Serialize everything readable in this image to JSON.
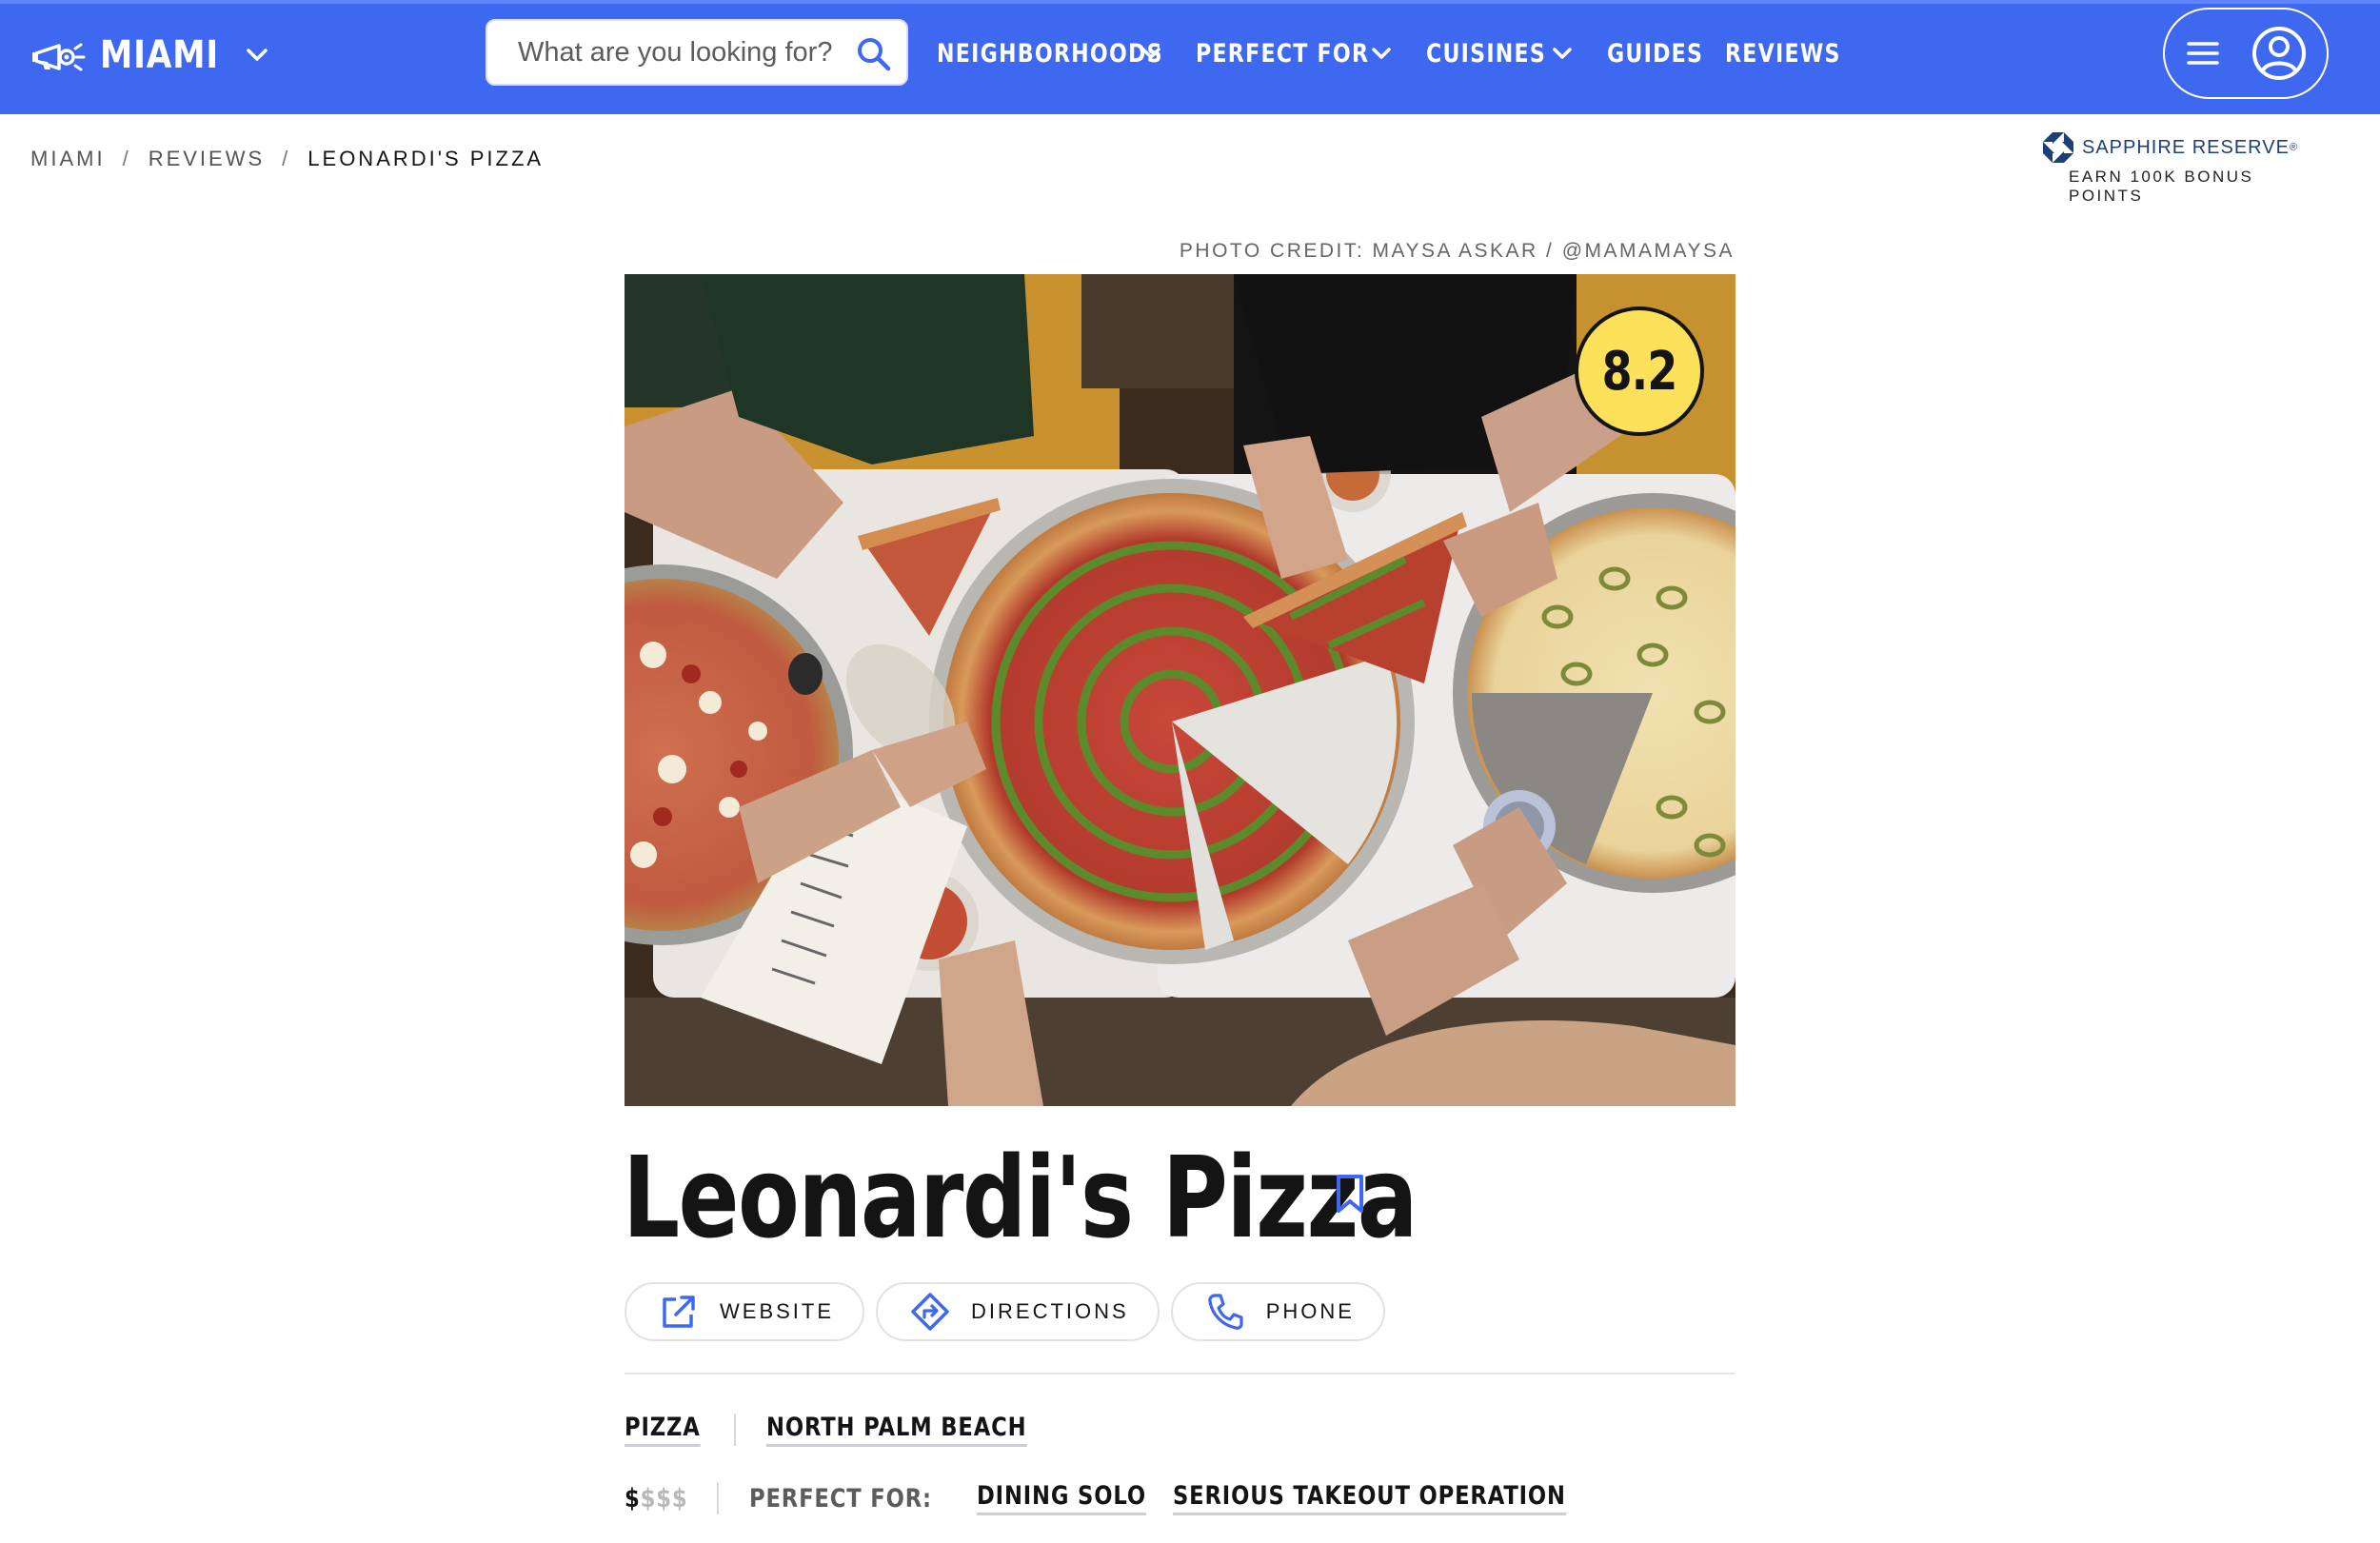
{
  "header": {
    "city": "MIAMI",
    "search_placeholder": "What are you looking for?",
    "nav": [
      {
        "label": "NEIGHBORHOODS",
        "has_dropdown": true
      },
      {
        "label": "PERFECT FOR",
        "has_dropdown": true
      },
      {
        "label": "CUISINES",
        "has_dropdown": true
      },
      {
        "label": "GUIDES",
        "has_dropdown": false
      },
      {
        "label": "REVIEWS",
        "has_dropdown": false
      }
    ],
    "bar_color": "#3f68f0"
  },
  "breadcrumb": [
    "MIAMI",
    "REVIEWS",
    "LEONARDI'S PIZZA"
  ],
  "breadcrumb_sep": "/",
  "sponsor": {
    "brand": "SAPPHIRE RESERVE",
    "registered": "®",
    "tagline": "EARN 100K BONUS POINTS"
  },
  "photo": {
    "credit": "PHOTO CREDIT: MAYSA ASKAR / @MAMAMAYSA",
    "score": "8.2",
    "score_color": "#fde15a"
  },
  "restaurant": {
    "name": "Leonardi's Pizza"
  },
  "actions": [
    {
      "label": "WEBSITE",
      "icon": "external-link-icon"
    },
    {
      "label": "DIRECTIONS",
      "icon": "directions-icon"
    },
    {
      "label": "PHONE",
      "icon": "phone-icon"
    }
  ],
  "tags": {
    "cuisine": "PIZZA",
    "neighborhood": "NORTH PALM BEACH",
    "price_active": "$",
    "price_inactive": "$$$",
    "perfect_for_label": "PERFECT FOR:",
    "perfect_for": [
      "DINING SOLO",
      "SERIOUS TAKEOUT OPERATION"
    ]
  }
}
